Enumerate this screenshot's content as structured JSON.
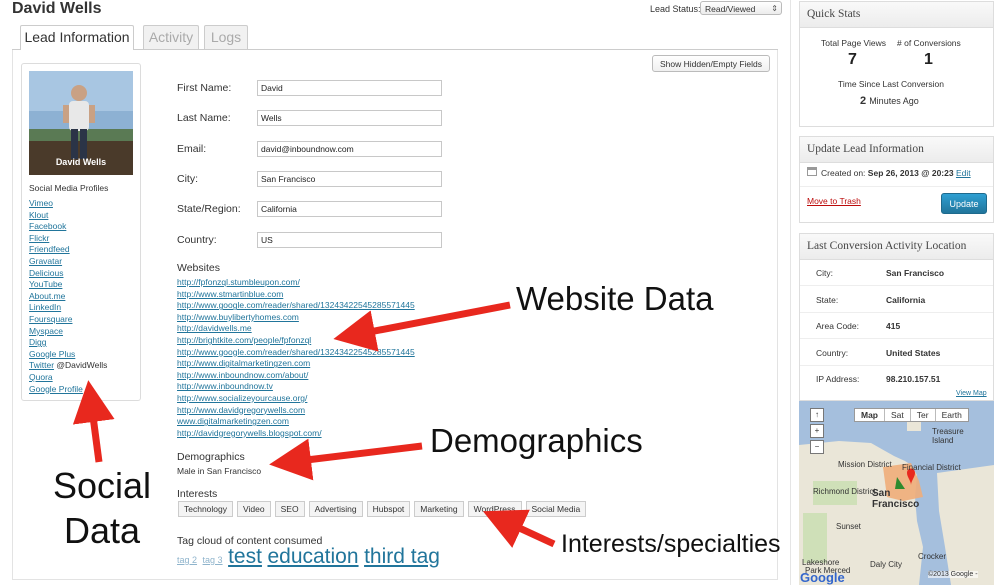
{
  "title": "David Wells",
  "lead_status": {
    "label": "Lead Status:",
    "value": "Read/Viewed"
  },
  "tabs": [
    "Lead Information",
    "Activity",
    "Logs"
  ],
  "show_hidden_button": "Show Hidden/Empty Fields",
  "profile": {
    "photo_caption": "David Wells",
    "social_heading": "Social Media Profiles",
    "social_links": [
      "Vimeo",
      "Klout",
      "Facebook",
      "Flickr",
      "Friendfeed",
      "Gravatar",
      "Delicious",
      "YouTube",
      "About.me",
      "LinkedIn",
      "Foursquare",
      "Myspace",
      "Digg",
      "Google Plus",
      "Twitter",
      "Quora",
      "Google Profile"
    ],
    "twitter_handle": "@DavidWells"
  },
  "fields": [
    {
      "label": "First Name:",
      "value": "David"
    },
    {
      "label": "Last Name:",
      "value": "Wells"
    },
    {
      "label": "Email:",
      "value": "david@inboundnow.com"
    },
    {
      "label": "City:",
      "value": "San Francisco"
    },
    {
      "label": "State/Region:",
      "value": "California"
    },
    {
      "label": "Country:",
      "value": "US"
    }
  ],
  "websites": {
    "heading": "Websites",
    "links": [
      "http://fpfonzql.stumbleupon.com/",
      "http://www.stmartinblue.com",
      "http://www.google.com/reader/shared/13243422545285571445",
      "http://www.buylibertyhomes.com",
      "http://davidwells.me",
      "http://brightkite.com/people/fpfonzql",
      "http://www.google.com/reader/shared/13243422545285571445",
      "http://www.digitalmarketingzen.com",
      "http://www.inboundnow.com/about/",
      "http://www.inboundnow.tv",
      "http://www.socializeyourcause.org/",
      "http://www.davidgregorywells.com",
      "www.digitalmarketingzen.com",
      "http://davidgregorywells.blogspot.com/"
    ]
  },
  "demographics": {
    "heading": "Demographics",
    "text": "Male in San Francisco"
  },
  "interests": {
    "heading": "Interests",
    "items": [
      "Technology",
      "Video",
      "SEO",
      "Advertising",
      "Hubspot",
      "Marketing",
      "WordPress",
      "Social Media"
    ]
  },
  "tag_cloud": {
    "heading": "Tag cloud of content consumed",
    "tags": [
      "tag 2",
      "tag 3",
      "test",
      "education",
      "third tag"
    ]
  },
  "annotations": {
    "website": "Website Data",
    "demographics": "Demographics",
    "interests": "Interests/specialties",
    "social_line1": "Social",
    "social_line2": "Data"
  },
  "quick_stats": {
    "title": "Quick Stats",
    "page_views_label": "Total Page Views",
    "page_views": "7",
    "conversions_label": "# of Conversions",
    "conversions": "1",
    "time_label": "Time Since Last Conversion",
    "time_num": "2",
    "time_unit": "Minutes Ago"
  },
  "update_box": {
    "title": "Update Lead Information",
    "created_label": "Created on:",
    "created_value": "Sep 26, 2013 @ 20:23",
    "edit_link": "Edit",
    "trash_link": "Move to Trash",
    "update_button": "Update"
  },
  "location": {
    "title": "Last Conversion Activity Location",
    "rows": [
      {
        "k": "City:",
        "v": "San Francisco"
      },
      {
        "k": "State:",
        "v": "California"
      },
      {
        "k": "Area Code:",
        "v": "415"
      },
      {
        "k": "Country:",
        "v": "United States"
      },
      {
        "k": "IP Address:",
        "v": "98.210.157.51"
      }
    ],
    "view_map": "View Map"
  },
  "map": {
    "tabs": [
      "Map",
      "Sat",
      "Ter",
      "Earth"
    ],
    "labels": [
      "Treasure Island",
      "Mission District",
      "Financial District",
      "Richmond District",
      "San Francisco",
      "Sunset",
      "Lakeshore",
      "Daly City",
      "Park Merced",
      "Crocker"
    ],
    "copyright": "©2013 Google -",
    "logo": "Google"
  },
  "colors": {
    "link": "#21759b",
    "accent_red": "#e8281e",
    "update_blue": "#21759b"
  }
}
